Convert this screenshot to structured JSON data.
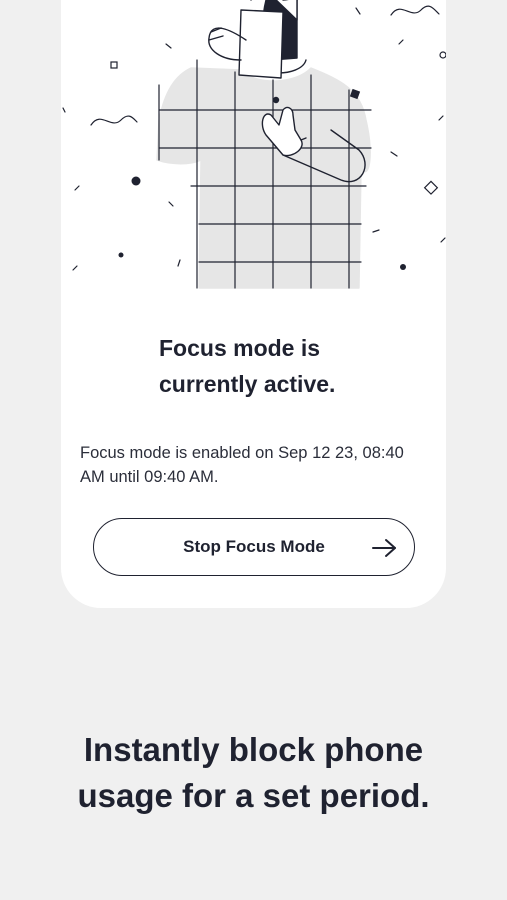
{
  "focus_card": {
    "status_title": "Focus mode is\ncurrently active.",
    "status_detail": "Focus mode is enabled on Sep 12 23, 08:40 AM until 09:40 AM.",
    "stop_button_label": "Stop Focus Mode",
    "arrow_icon": "arrow-right-icon",
    "illustration": "person-covering-face-illustration"
  },
  "promo": {
    "tagline": "Instantly block phone\nusage for a set period."
  },
  "colors": {
    "background": "#f0f0f0",
    "card": "#ffffff",
    "text": "#1f2230",
    "illustration_fill": "#e6e6e6"
  }
}
